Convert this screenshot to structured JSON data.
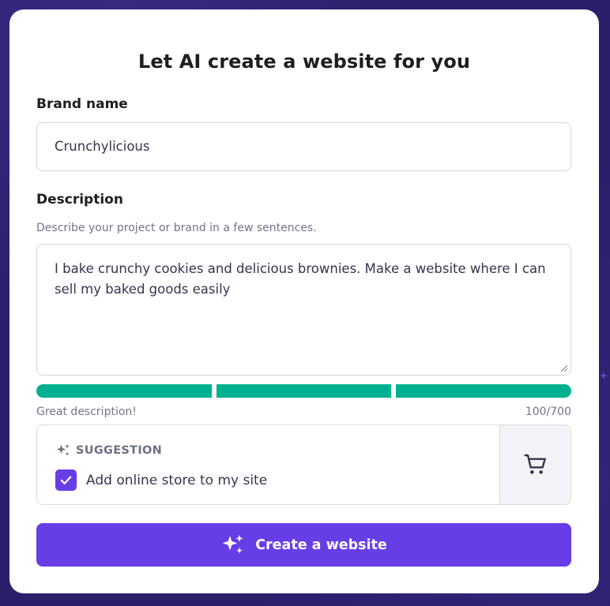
{
  "dialog": {
    "title": "Let AI create a website for you"
  },
  "brand": {
    "label": "Brand name",
    "value": "Crunchylicious"
  },
  "description": {
    "label": "Description",
    "helper": "Describe your project or brand in a few sentences.",
    "value": "I bake crunchy cookies and delicious brownies. Make a website where I can sell my baked goods easily",
    "quality_segments_filled": 3,
    "quality_segments_total": 3,
    "quality_message": "Great description!",
    "char_count": "100/700"
  },
  "suggestion": {
    "heading": "SUGGESTION",
    "option_label": "Add online store to my site",
    "checked": true,
    "icon": "cart-icon"
  },
  "actions": {
    "create_label": "Create a website"
  },
  "colors": {
    "accent": "#673de6",
    "progress": "#00b090",
    "background": "#2a1f6b"
  }
}
